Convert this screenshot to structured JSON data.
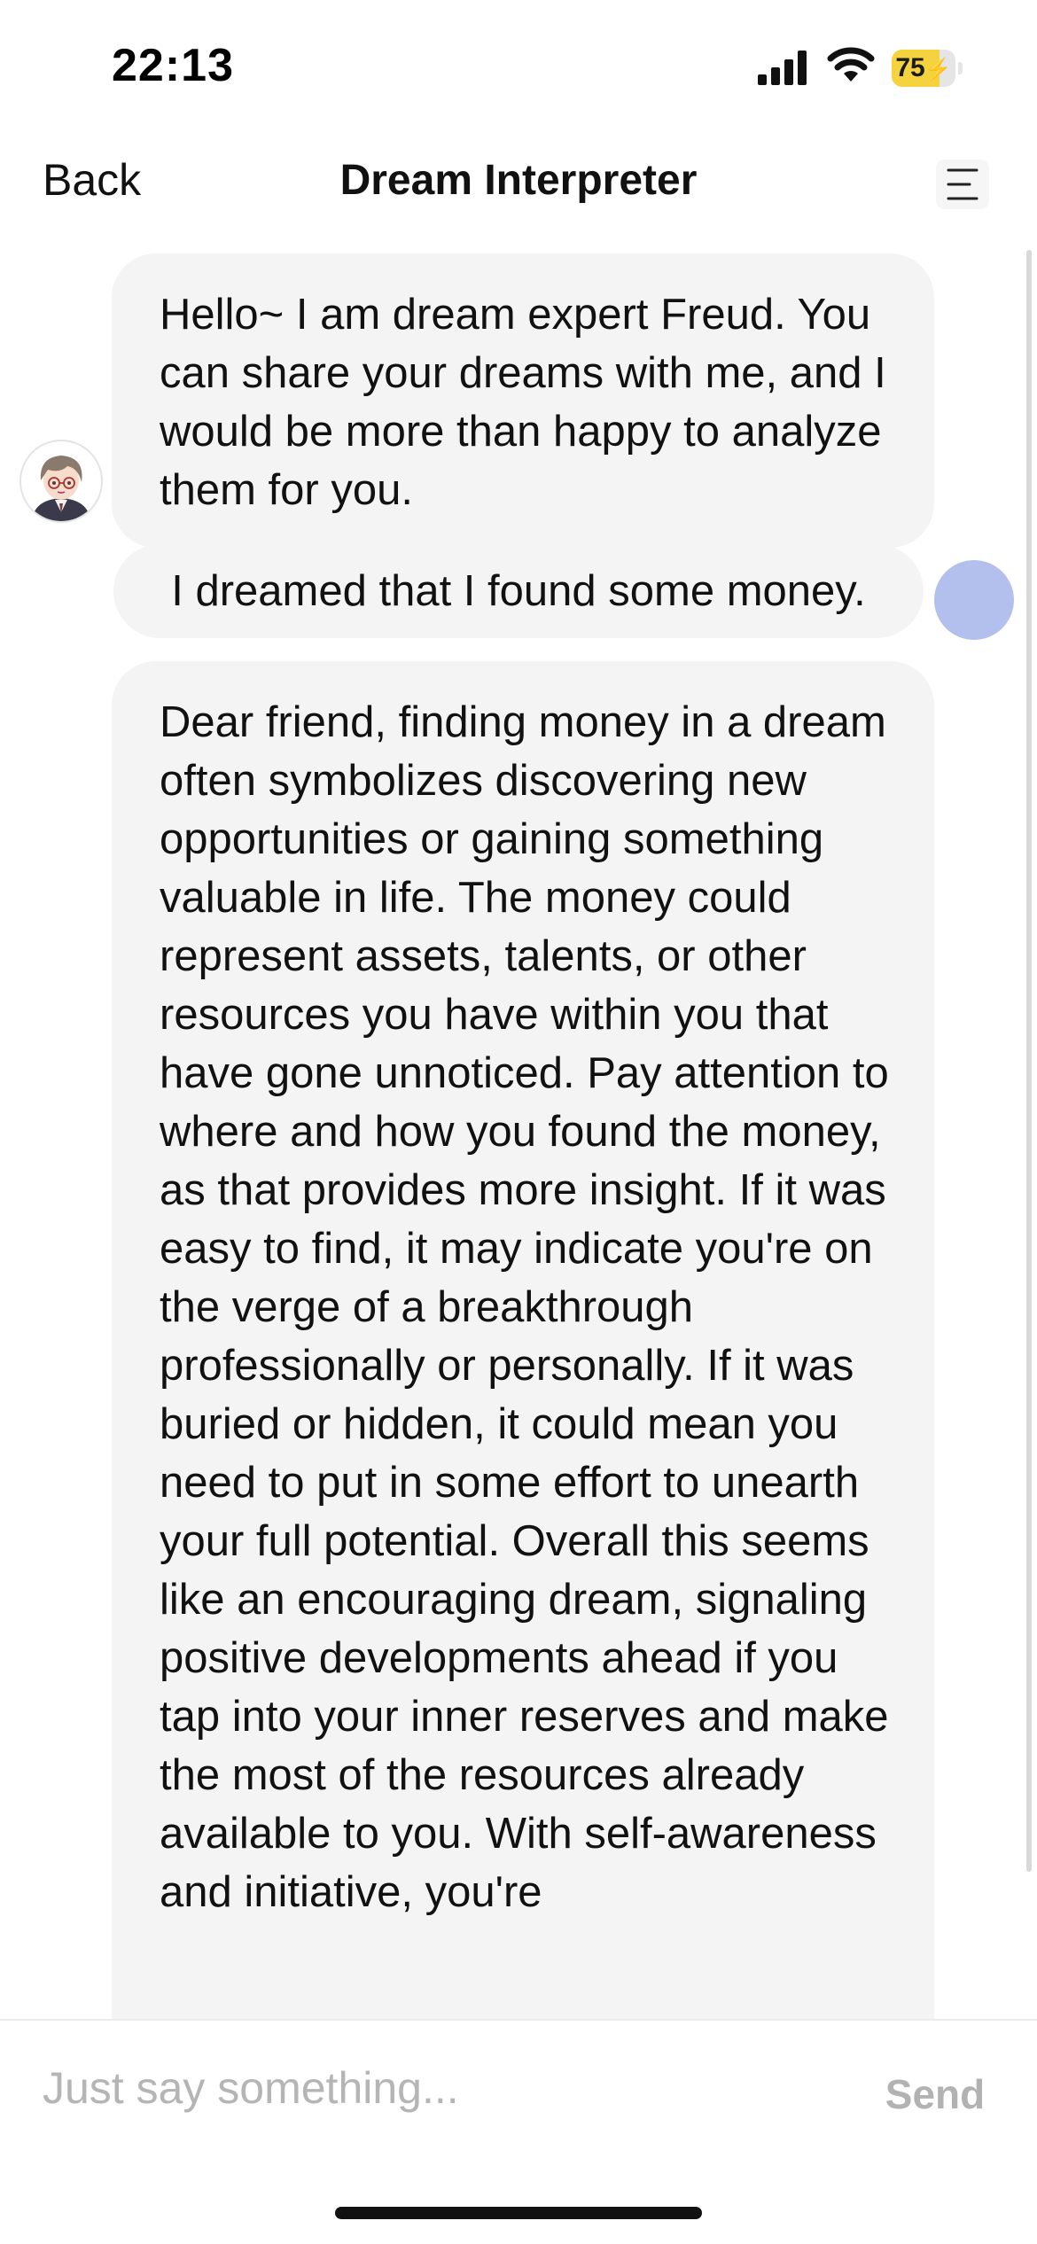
{
  "status_bar": {
    "time": "22:13",
    "battery_level": "75",
    "battery_fraction": 0.75,
    "battery_color": "#f5d33f",
    "icons": [
      "signal-icon",
      "wifi-icon",
      "battery-icon"
    ]
  },
  "nav": {
    "back_label": "Back",
    "title": "Dream Interpreter",
    "menu_icon": "menu-icon"
  },
  "messages": [
    {
      "role": "assistant",
      "text": "Hello~ I am dream expert Freud. You can share your dreams with me, and I would be more than happy to analyze them for you."
    },
    {
      "role": "user",
      "text": "I dreamed that I found some money."
    },
    {
      "role": "assistant",
      "text": "Dear friend, finding money in a dream often symbolizes discovering new opportunities or gaining something valuable in life. The money could represent assets, talents, or other resources you have within you that have gone unnoticed. Pay attention to where and how you found the money, as that provides more insight. If it was easy to find, it may indicate you're on the verge of a breakthrough professionally or personally. If it was buried or hidden, it could mean you need to put in some effort to unearth your full potential. Overall this seems like an encouraging dream, signaling positive developments ahead if you tap into your inner reserves and make the most of the resources already available to you. With self-awareness and initiative, you're"
    }
  ],
  "colors": {
    "bubble": "#f4f4f4",
    "user_avatar": "#b3c0ee",
    "placeholder": "#b5b5b5",
    "send_disabled": "#b2b2b2"
  },
  "input": {
    "placeholder": "Just say something...",
    "value": "",
    "send_label": "Send"
  }
}
